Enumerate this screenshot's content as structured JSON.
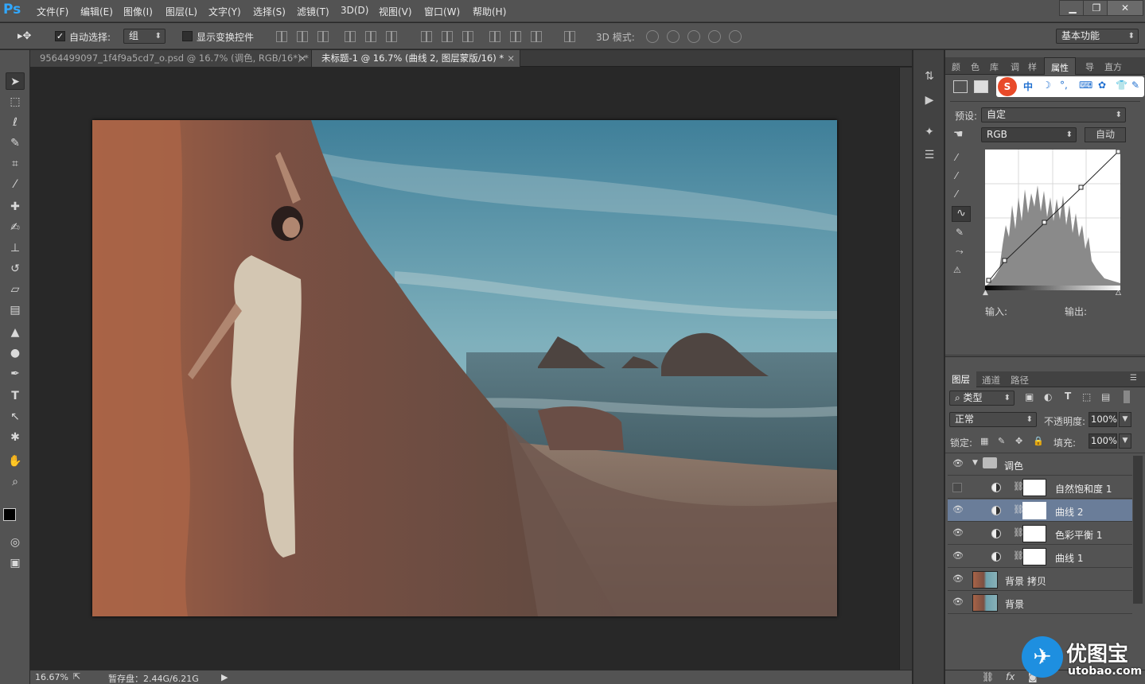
{
  "app": {
    "logo": "Ps"
  },
  "menu": [
    "文件(F)",
    "编辑(E)",
    "图像(I)",
    "图层(L)",
    "文字(Y)",
    "选择(S)",
    "滤镜(T)",
    "3D(D)",
    "视图(V)",
    "窗口(W)",
    "帮助(H)"
  ],
  "window_buttons": {
    "minimize": "▁",
    "restore": "❐",
    "close": "✕"
  },
  "options": {
    "auto_select_label": "自动选择:",
    "auto_select_value": "组",
    "show_transform_label": "显示变换控件",
    "mode3d_label": "3D 模式:",
    "workspace": "基本功能"
  },
  "tabs": [
    {
      "title": "9564499097_1f4f9a5cd7_o.psd @ 16.7% (调色, RGB/16*) *",
      "close": "×"
    },
    {
      "title": "未标题-1 @ 16.7% (曲线 2, 图层蒙版/16) *",
      "close": "×"
    }
  ],
  "status": {
    "zoom": "16.67%",
    "scratch": "暂存盘：2.44G/6.21G"
  },
  "panel_tabs_top": [
    "颜",
    "色",
    "库",
    "调",
    "样",
    "属性",
    "导",
    "直方"
  ],
  "properties": {
    "preset_label": "预设:",
    "preset_value": "自定",
    "channel": "RGB",
    "auto_button": "自动",
    "input_label": "输入:",
    "output_label": "输出:"
  },
  "layers_tabs": [
    "图层",
    "通道",
    "路径"
  ],
  "layers_controls": {
    "filter_kind": "类型",
    "blend_mode": "正常",
    "opacity_label": "不透明度:",
    "opacity_value": "100%",
    "lock_label": "锁定:",
    "fill_label": "填充:",
    "fill_value": "100%"
  },
  "layers": [
    {
      "name": "调色",
      "type": "group",
      "visible": true
    },
    {
      "name": "自然饱和度 1",
      "type": "adjustment",
      "visible": false
    },
    {
      "name": "曲线 2",
      "type": "adjustment",
      "visible": true,
      "selected": true
    },
    {
      "name": "色彩平衡 1",
      "type": "adjustment",
      "visible": true
    },
    {
      "name": "曲线 1",
      "type": "adjustment",
      "visible": true
    },
    {
      "name": "背景  拷贝",
      "type": "image",
      "visible": true
    },
    {
      "name": "背景",
      "type": "image",
      "visible": true
    }
  ],
  "watermark": {
    "brand": "优图宝",
    "site": "utobao.com"
  },
  "colors": {
    "accent": "#31a8ff",
    "selected_layer": "#6a7d99"
  }
}
